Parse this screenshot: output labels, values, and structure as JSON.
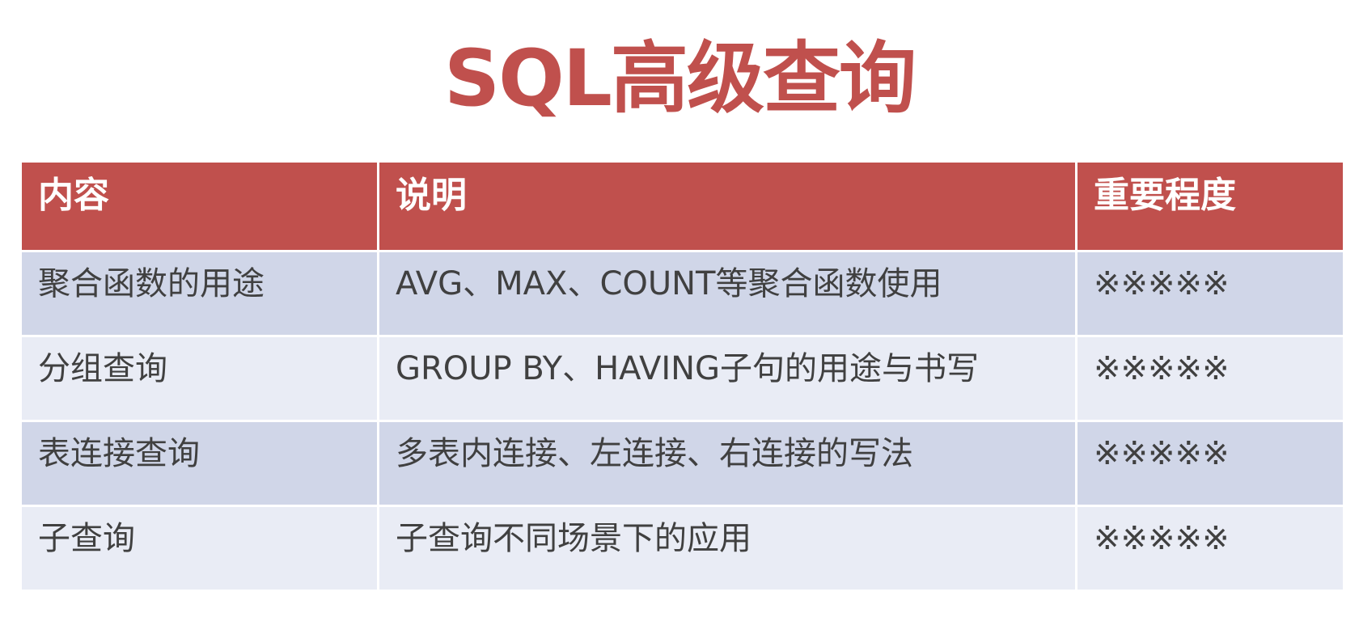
{
  "title": "SQL高级查询",
  "table": {
    "headers": [
      "内容",
      "说明",
      "重要程度"
    ],
    "rows": [
      [
        "聚合函数的用途",
        "AVG、MAX、COUNT等聚合函数使用",
        "※※※※※"
      ],
      [
        "分组查询",
        "GROUP BY、HAVING子句的用途与书写",
        "※※※※※"
      ],
      [
        "表连接查询",
        "多表内连接、左连接、右连接的写法",
        "※※※※※"
      ],
      [
        "子查询",
        "子查询不同场景下的应用",
        "※※※※※"
      ]
    ]
  },
  "colors": {
    "accent": "#c0504d",
    "row_dark": "#d0d6e8",
    "row_light": "#e9ecf5",
    "text": "#404040"
  }
}
